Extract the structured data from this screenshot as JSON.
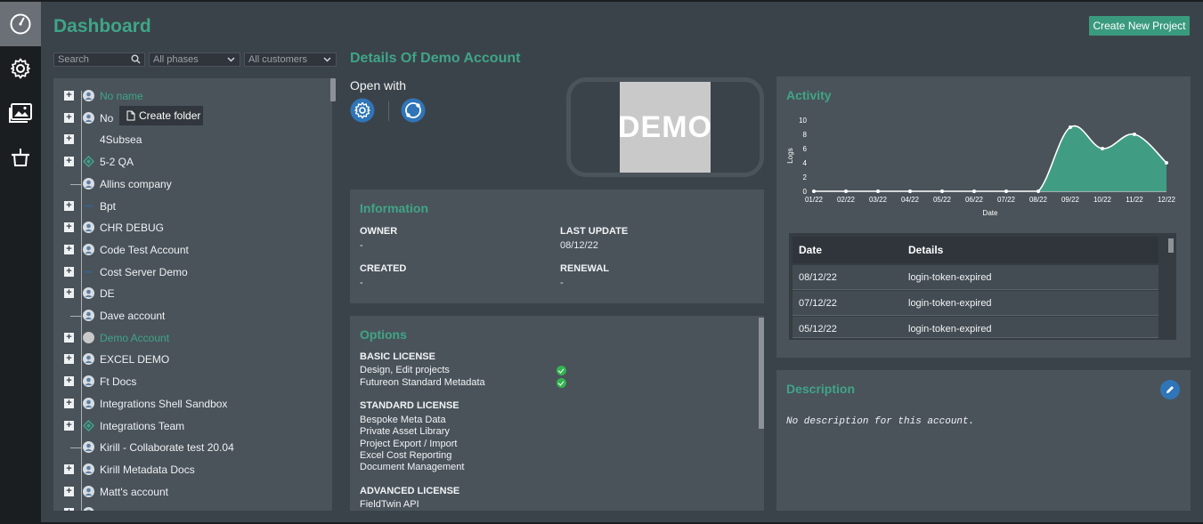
{
  "header": {
    "title": "Dashboard",
    "create_button": "Create New Project"
  },
  "filters": {
    "search_placeholder": "Search",
    "phases_label": "All phases",
    "customers_label": "All customers"
  },
  "tooltip": {
    "label": "Create folder"
  },
  "tree": {
    "items": [
      {
        "label": "No name",
        "plus": true,
        "icon": "user",
        "green": true
      },
      {
        "label": "No",
        "plus": true,
        "icon": "user",
        "green": false
      },
      {
        "label": "4Subsea",
        "plus": true,
        "icon": "none",
        "green": false
      },
      {
        "label": "5-2 QA",
        "plus": true,
        "icon": "diamond",
        "green": false
      },
      {
        "label": "Allins company",
        "plus": false,
        "icon": "user",
        "green": false
      },
      {
        "label": "Bpt",
        "plus": true,
        "icon": "dash",
        "green": false
      },
      {
        "label": "CHR DEBUG",
        "plus": true,
        "icon": "user",
        "green": false
      },
      {
        "label": "Code Test Account",
        "plus": true,
        "icon": "user",
        "green": false
      },
      {
        "label": "Cost Server Demo",
        "plus": true,
        "icon": "dash",
        "green": false
      },
      {
        "label": "DE",
        "plus": true,
        "icon": "user",
        "green": false
      },
      {
        "label": "Dave account",
        "plus": false,
        "icon": "user",
        "green": false
      },
      {
        "label": "Demo Account",
        "plus": true,
        "icon": "grey",
        "green": true
      },
      {
        "label": "EXCEL DEMO",
        "plus": true,
        "icon": "user",
        "green": false
      },
      {
        "label": "Ft Docs",
        "plus": true,
        "icon": "user",
        "green": false
      },
      {
        "label": "Integrations Shell Sandbox",
        "plus": true,
        "icon": "user",
        "green": false
      },
      {
        "label": "Integrations Team",
        "plus": true,
        "icon": "diamond",
        "green": false
      },
      {
        "label": "Kirill - Collaborate test 20.04",
        "plus": false,
        "icon": "user",
        "green": false
      },
      {
        "label": "Kirill Metadata Docs",
        "plus": true,
        "icon": "user",
        "green": false
      },
      {
        "label": "Matt's account",
        "plus": true,
        "icon": "user",
        "green": false
      },
      {
        "label": "",
        "plus": true,
        "icon": "user",
        "green": false
      }
    ]
  },
  "details": {
    "title": "Details Of Demo Account",
    "open_with": "Open with",
    "logo_text": "DEMO"
  },
  "information": {
    "title": "Information",
    "owner_label": "OWNER",
    "owner_value": "-",
    "last_update_label": "LAST UPDATE",
    "last_update_value": "08/12/22",
    "created_label": "CREATED",
    "created_value": "-",
    "renewal_label": "RENEWAL",
    "renewal_value": "-"
  },
  "options": {
    "title": "Options",
    "basic_label": "BASIC LICENSE",
    "basic_items": [
      "Design, Edit projects",
      "Futureon Standard Metadata"
    ],
    "standard_label": "STANDARD LICENSE",
    "standard_items": [
      "Bespoke Meta Data",
      "Private Asset Library",
      "Project Export / Import",
      "Excel Cost Reporting",
      "Document Management"
    ],
    "advanced_label": "ADVANCED LICENSE",
    "advanced_items": [
      "FieldTwin API"
    ]
  },
  "activity": {
    "title": "Activity",
    "table_headers": [
      "Date",
      "Details"
    ],
    "rows": [
      {
        "date": "08/12/22",
        "details": "login-token-expired"
      },
      {
        "date": "07/12/22",
        "details": "login-token-expired"
      },
      {
        "date": "05/12/22",
        "details": "login-token-expired"
      }
    ]
  },
  "description": {
    "title": "Description",
    "text": "No description for this account."
  },
  "colors": {
    "accent": "#3fa587",
    "panel": "#4a535a",
    "background": "#3b434a"
  },
  "chart_data": {
    "type": "area",
    "categories": [
      "01/22",
      "02/22",
      "03/22",
      "04/22",
      "05/22",
      "06/22",
      "07/22",
      "08/22",
      "09/22",
      "10/22",
      "11/22",
      "12/22"
    ],
    "values": [
      0,
      0,
      0,
      0,
      0,
      0,
      0,
      0,
      9,
      6,
      8,
      4
    ],
    "xlabel": "Date",
    "ylabel": "Logs",
    "ylim": [
      0,
      10
    ],
    "yticks": [
      0,
      2,
      4,
      6,
      8,
      10
    ],
    "grid": false,
    "color": "#3fa587"
  }
}
